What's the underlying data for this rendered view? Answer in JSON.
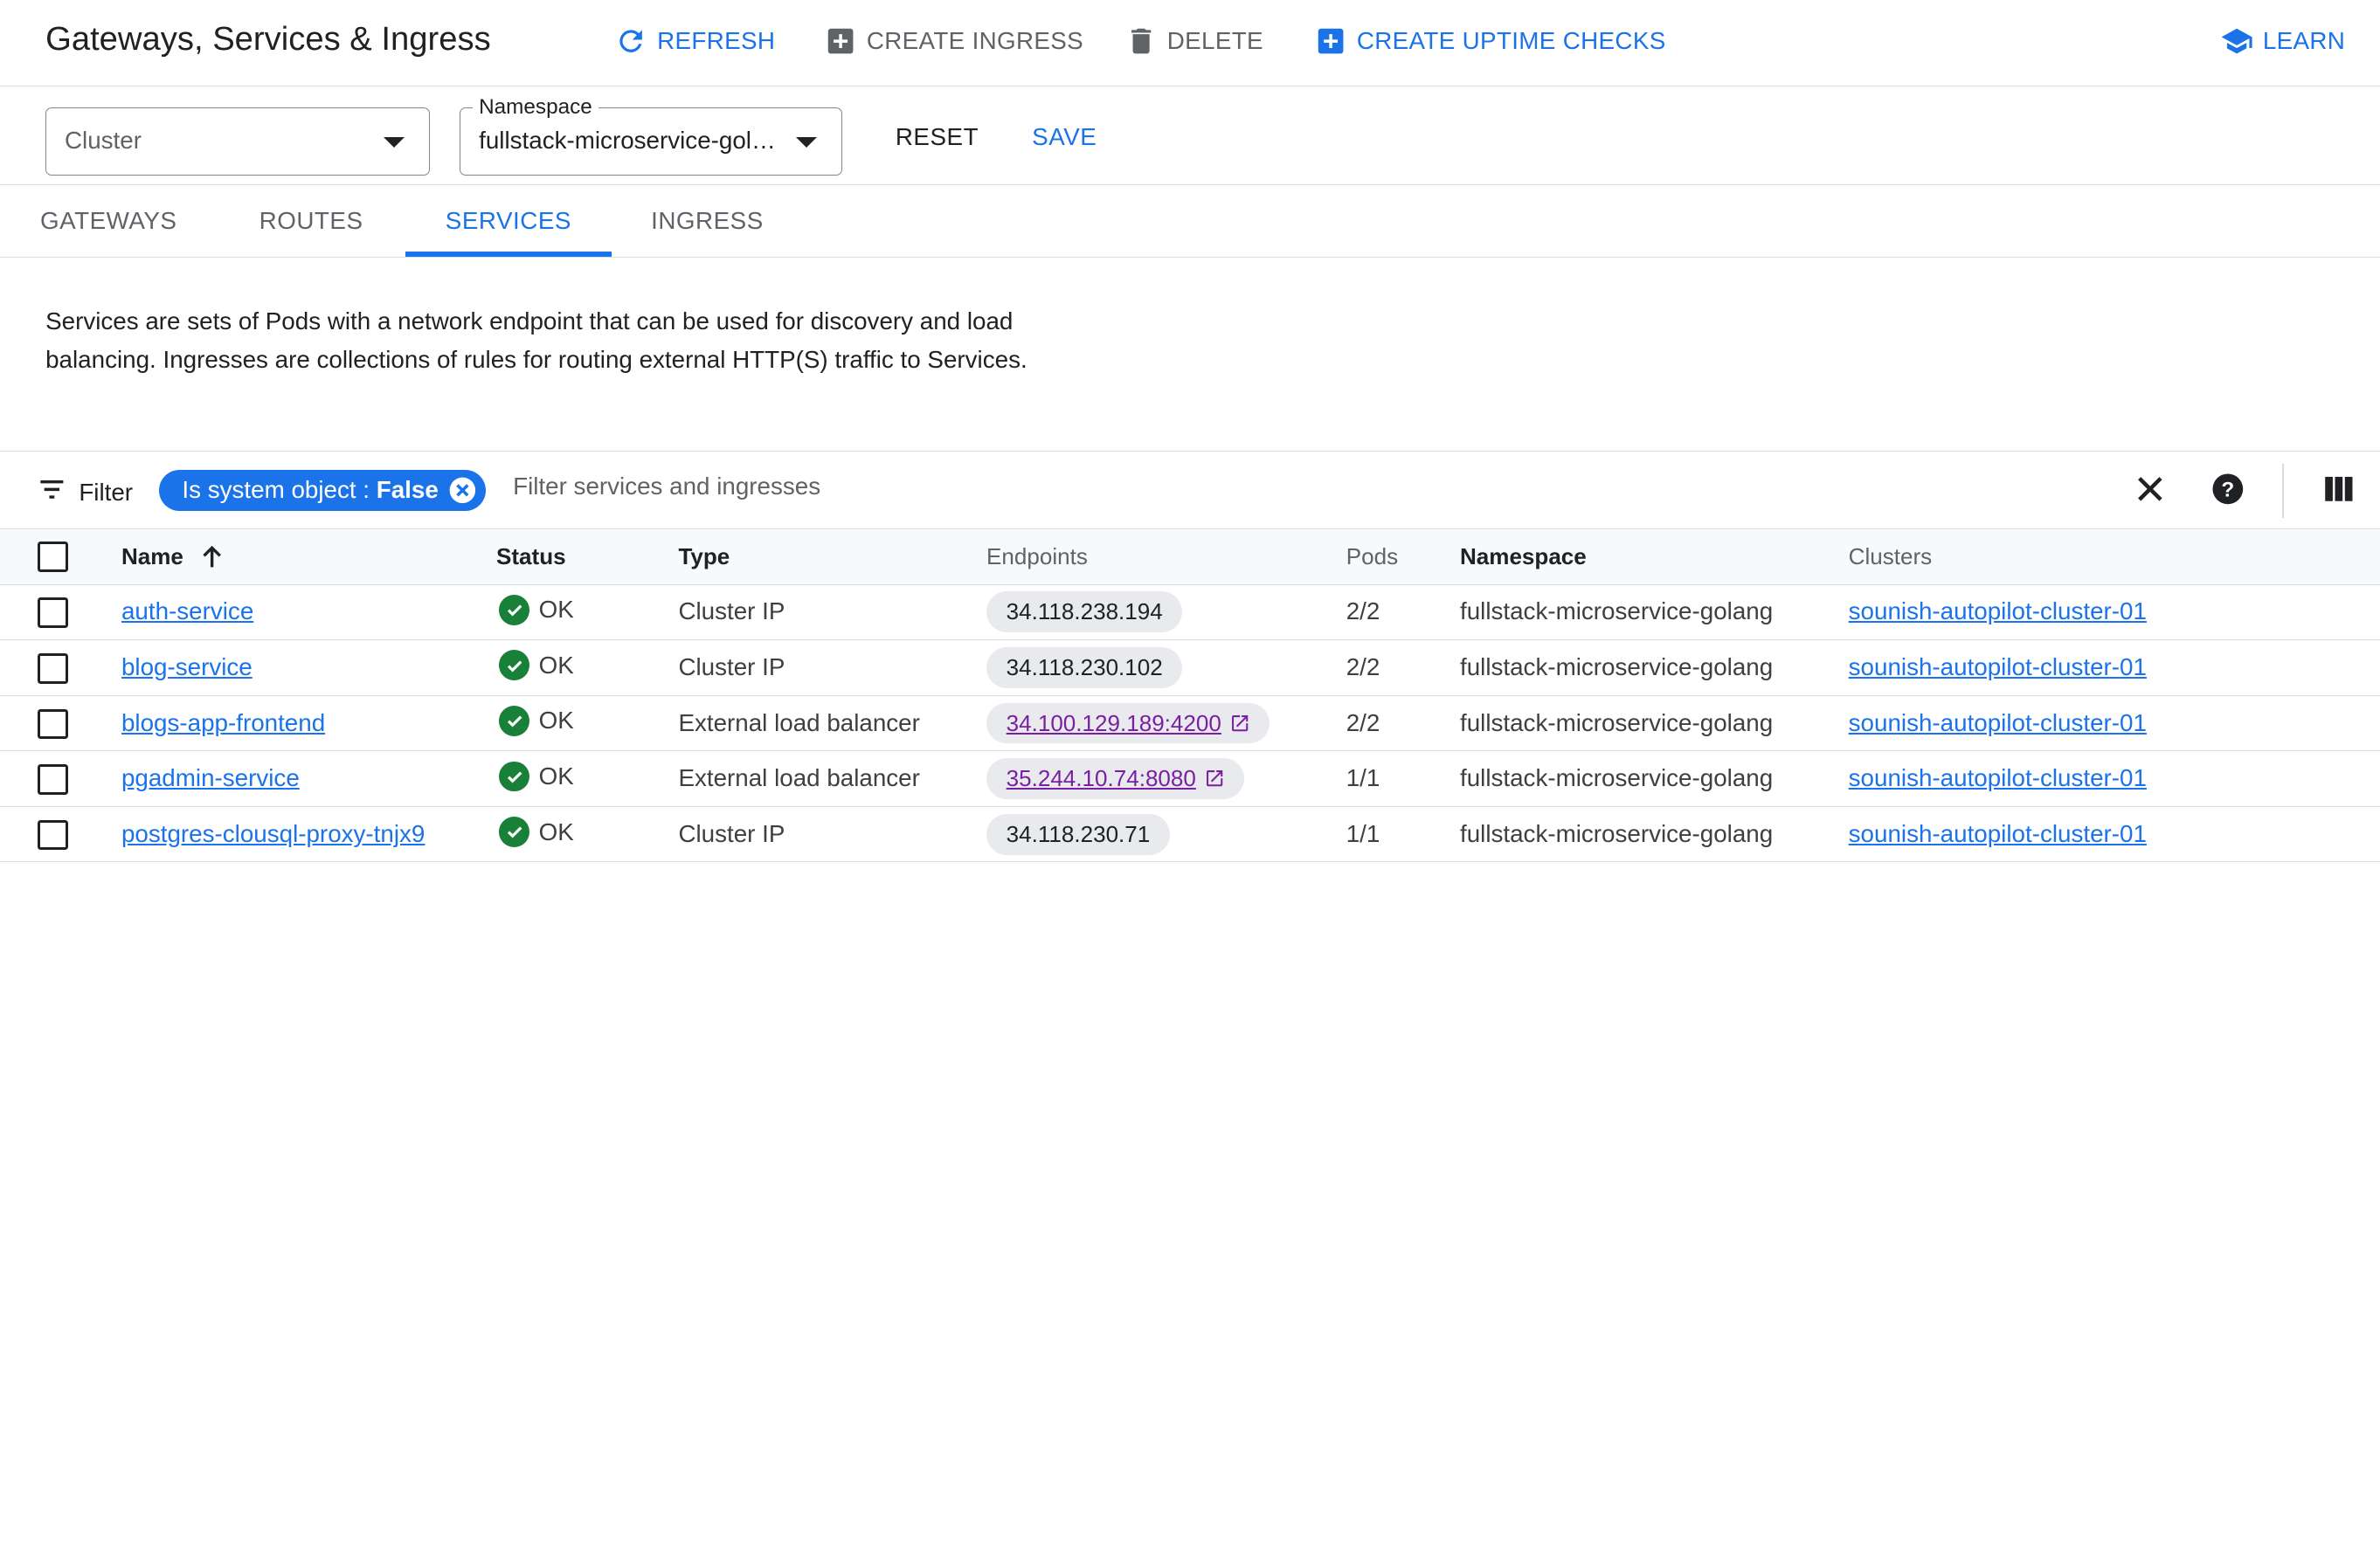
{
  "header": {
    "title": "Gateways, Services & Ingress",
    "refresh_label": "REFRESH",
    "create_ingress_label": "CREATE INGRESS",
    "delete_label": "DELETE",
    "create_uptime_label": "CREATE UPTIME CHECKS",
    "learn_label": "LEARN"
  },
  "filters": {
    "cluster_placeholder": "Cluster",
    "namespace_label": "Namespace",
    "namespace_value": "fullstack-microservice-gol…",
    "reset_label": "RESET",
    "save_label": "SAVE"
  },
  "tabs": [
    "GATEWAYS",
    "ROUTES",
    "SERVICES",
    "INGRESS"
  ],
  "description": "Services are sets of Pods with a network endpoint that can be used for discovery and load balancing. Ingresses are collections of rules for routing external HTTP(S) traffic to Services.",
  "table_filter": {
    "filter_label": "Filter",
    "chip_key": "Is system object : ",
    "chip_value": "False",
    "placeholder": "Filter services and ingresses"
  },
  "table": {
    "columns": [
      "Name",
      "Status",
      "Type",
      "Endpoints",
      "Pods",
      "Namespace",
      "Clusters"
    ],
    "rows": [
      {
        "name": "auth-service",
        "status": "OK",
        "type": "Cluster IP",
        "endpoint": "34.118.238.194",
        "external": false,
        "pods": "2/2",
        "namespace": "fullstack-microservice-golang",
        "cluster": "sounish-autopilot-cluster-01"
      },
      {
        "name": "blog-service",
        "status": "OK",
        "type": "Cluster IP",
        "endpoint": "34.118.230.102",
        "external": false,
        "pods": "2/2",
        "namespace": "fullstack-microservice-golang",
        "cluster": "sounish-autopilot-cluster-01"
      },
      {
        "name": "blogs-app-frontend",
        "status": "OK",
        "type": "External load balancer",
        "endpoint": "34.100.129.189:4200",
        "external": true,
        "pods": "2/2",
        "namespace": "fullstack-microservice-golang",
        "cluster": "sounish-autopilot-cluster-01"
      },
      {
        "name": "pgadmin-service",
        "status": "OK",
        "type": "External load balancer",
        "endpoint": "35.244.10.74:8080",
        "external": true,
        "pods": "1/1",
        "namespace": "fullstack-microservice-golang",
        "cluster": "sounish-autopilot-cluster-01"
      },
      {
        "name": "postgres-clousql-proxy-tnjx9",
        "status": "OK",
        "type": "Cluster IP",
        "endpoint": "34.118.230.71",
        "external": false,
        "pods": "1/1",
        "namespace": "fullstack-microservice-golang",
        "cluster": "sounish-autopilot-cluster-01"
      }
    ]
  },
  "colors": {
    "accent": "#1a73e8",
    "ok": "#188038",
    "external_link": "#7b1fa2"
  }
}
